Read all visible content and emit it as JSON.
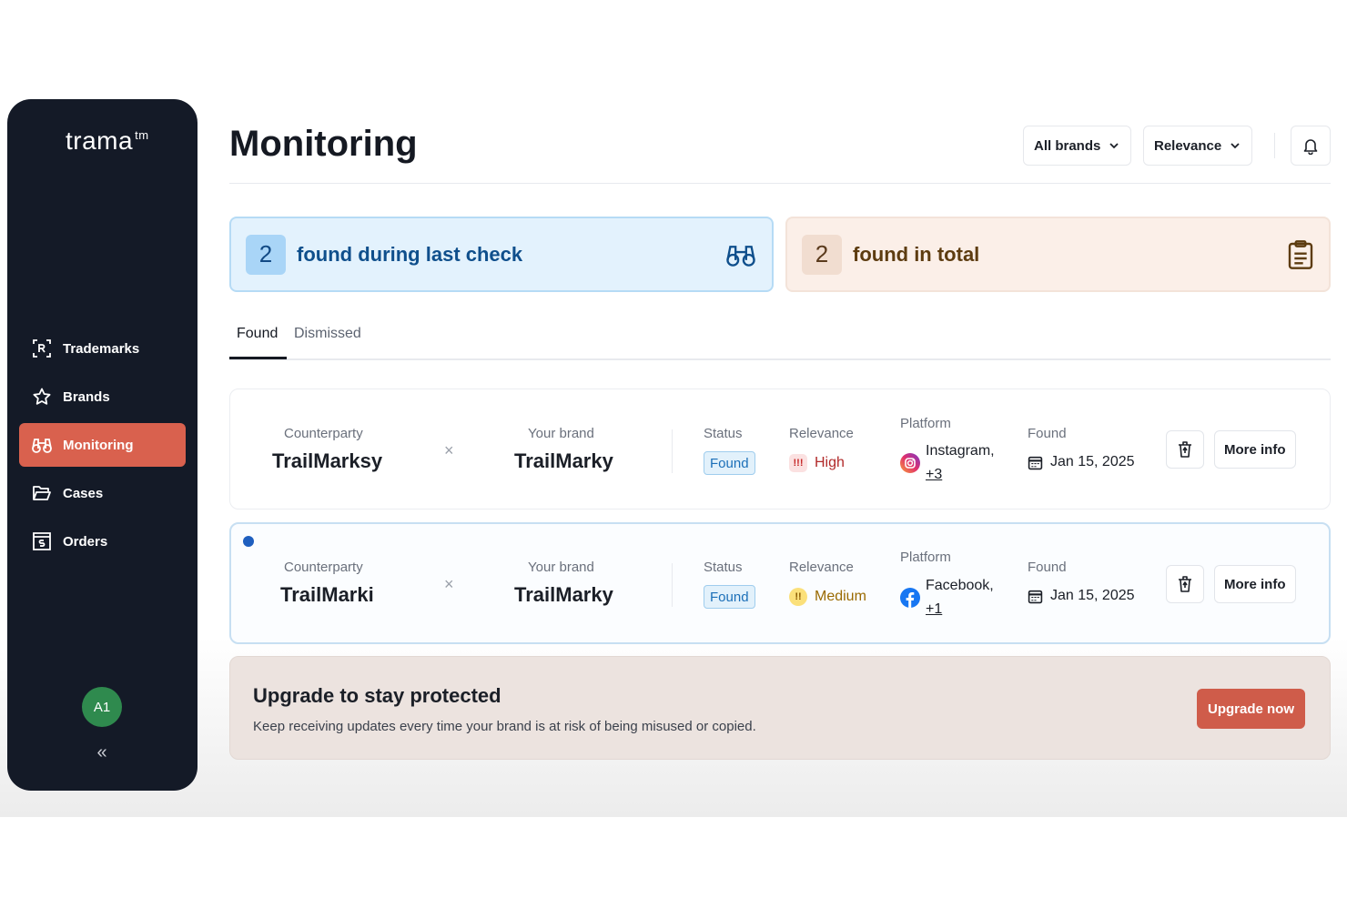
{
  "app": {
    "logo": "trama",
    "logo_sup": "tm"
  },
  "sidebar": {
    "items": [
      {
        "label": "Trademarks",
        "icon": "trademark-r-icon"
      },
      {
        "label": "Brands",
        "icon": "star-icon"
      },
      {
        "label": "Monitoring",
        "icon": "binoculars-icon",
        "active": true
      },
      {
        "label": "Cases",
        "icon": "folder-icon"
      },
      {
        "label": "Orders",
        "icon": "dollar-receipt-icon"
      }
    ],
    "avatar": "A1",
    "collapse": "«"
  },
  "header": {
    "title": "Monitoring",
    "brand_filter": "All brands",
    "sort_filter": "Relevance"
  },
  "stats": {
    "last_check": {
      "count": "2",
      "label": "found during last check"
    },
    "total": {
      "count": "2",
      "label": "found in total"
    }
  },
  "tabs": {
    "found": "Found",
    "dismissed": "Dismissed"
  },
  "labels": {
    "counterparty": "Counterparty",
    "your_brand": "Your brand",
    "status": "Status",
    "relevance": "Relevance",
    "platform": "Platform",
    "found": "Found",
    "more_info": "More info"
  },
  "rows": [
    {
      "counterparty": "TrailMarksy",
      "your_brand": "TrailMarky",
      "status": "Found",
      "relevance": "High",
      "relevance_icon": "!!!",
      "platform": "Instagram,",
      "platform_more": "+3",
      "found_date": "Jan 15, 2025",
      "unread": false
    },
    {
      "counterparty": "TrailMarki",
      "your_brand": "TrailMarky",
      "status": "Found",
      "relevance": "Medium",
      "relevance_icon": "!!",
      "platform": "Facebook,",
      "platform_more": "+1",
      "found_date": "Jan 15, 2025",
      "unread": true
    }
  ],
  "upgrade": {
    "title": "Upgrade to stay protected",
    "subtitle": "Keep receiving updates every time your brand is at risk of being misused or copied.",
    "button": "Upgrade now"
  },
  "colors": {
    "sidebar_bg": "#141a27",
    "accent": "#d9614e",
    "info_blue": "#e3f2fd",
    "peach": "#fbefe8"
  }
}
